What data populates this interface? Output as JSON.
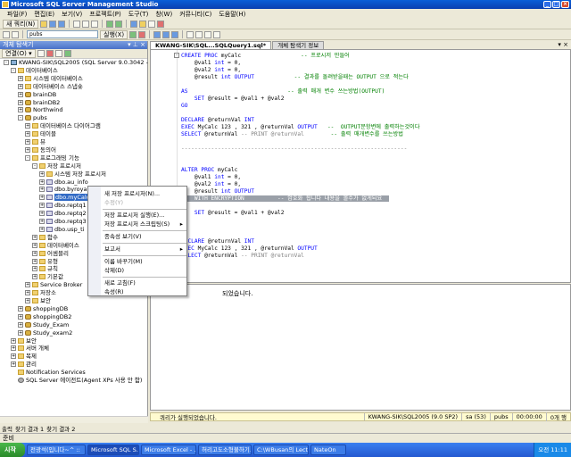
{
  "window": {
    "title": "Microsoft SQL Server Management Studio"
  },
  "menu": [
    "파일(F)",
    "편집(E)",
    "보기(V)",
    "프로젝트(P)",
    "도구(T)",
    "창(W)",
    "커뮤니티(C)",
    "도움말(H)"
  ],
  "toolbar": {
    "new_query": "새 쿼리(N)",
    "db_select": "pubs",
    "execute": "실행(X)"
  },
  "object_explorer": {
    "title": "개체 탐색기",
    "connect": "연결(O) ▾",
    "tree": [
      {
        "label": "KWANG-SIK\\SQL2005 (SQL Server 9.0.3042 - sa",
        "depth": 0,
        "icon": "server",
        "exp": "-"
      },
      {
        "label": "데이터베이스",
        "depth": 1,
        "icon": "folder",
        "exp": "-"
      },
      {
        "label": "시스템 데이터베이스",
        "depth": 2,
        "icon": "folder",
        "exp": "+"
      },
      {
        "label": "데이터베이스 스냅숏",
        "depth": 2,
        "icon": "folder",
        "exp": "+"
      },
      {
        "label": "brainDB",
        "depth": 2,
        "icon": "db",
        "exp": "+"
      },
      {
        "label": "brainDB2",
        "depth": 2,
        "icon": "db",
        "exp": "+"
      },
      {
        "label": "Northwind",
        "depth": 2,
        "icon": "db",
        "exp": "+"
      },
      {
        "label": "pubs",
        "depth": 2,
        "icon": "db",
        "exp": "-"
      },
      {
        "label": "데이터베이스 다이어그램",
        "depth": 3,
        "icon": "folder",
        "exp": "+"
      },
      {
        "label": "테이블",
        "depth": 3,
        "icon": "folder",
        "exp": "+"
      },
      {
        "label": "뷰",
        "depth": 3,
        "icon": "folder",
        "exp": "+"
      },
      {
        "label": "동의어",
        "depth": 3,
        "icon": "folder",
        "exp": "+"
      },
      {
        "label": "프로그래밍 기능",
        "depth": 3,
        "icon": "folder",
        "exp": "-"
      },
      {
        "label": "저장 프로시저",
        "depth": 4,
        "icon": "folder",
        "exp": "-"
      },
      {
        "label": "시스템 저장 프로시저",
        "depth": 5,
        "icon": "folder",
        "exp": "+"
      },
      {
        "label": "dbo.au_info",
        "depth": 5,
        "icon": "sp",
        "exp": "+"
      },
      {
        "label": "dbo.byroyalty",
        "depth": 5,
        "icon": "sp",
        "exp": "+"
      },
      {
        "label": "dbo.myCalc",
        "depth": 5,
        "icon": "sp",
        "exp": "+",
        "selected": true
      },
      {
        "label": "dbo.reptq1",
        "depth": 5,
        "icon": "sp",
        "exp": "+"
      },
      {
        "label": "dbo.reptq2",
        "depth": 5,
        "icon": "sp",
        "exp": "+"
      },
      {
        "label": "dbo.reptq3",
        "depth": 5,
        "icon": "sp",
        "exp": "+"
      },
      {
        "label": "dbo.usp_ti",
        "depth": 5,
        "icon": "sp",
        "exp": "+"
      },
      {
        "label": "함수",
        "depth": 4,
        "icon": "folder",
        "exp": "+"
      },
      {
        "label": "데이터베이스",
        "depth": 4,
        "icon": "folder",
        "exp": "+"
      },
      {
        "label": "어셈블리",
        "depth": 4,
        "icon": "folder",
        "exp": "+"
      },
      {
        "label": "유형",
        "depth": 4,
        "icon": "folder",
        "exp": "+"
      },
      {
        "label": "규칙",
        "depth": 4,
        "icon": "folder",
        "exp": "+"
      },
      {
        "label": "기본값",
        "depth": 4,
        "icon": "folder",
        "exp": "+"
      },
      {
        "label": "Service Broker",
        "depth": 3,
        "icon": "folder",
        "exp": "+"
      },
      {
        "label": "저장소",
        "depth": 3,
        "icon": "folder",
        "exp": "+"
      },
      {
        "label": "보안",
        "depth": 3,
        "icon": "folder",
        "exp": "+"
      },
      {
        "label": "shoppingDB",
        "depth": 2,
        "icon": "db",
        "exp": "+"
      },
      {
        "label": "shoppingDB2",
        "depth": 2,
        "icon": "db",
        "exp": "+"
      },
      {
        "label": "Study_Exam",
        "depth": 2,
        "icon": "db",
        "exp": "+"
      },
      {
        "label": "Study_exam2",
        "depth": 2,
        "icon": "db",
        "exp": "+"
      },
      {
        "label": "보안",
        "depth": 1,
        "icon": "folder",
        "exp": "+"
      },
      {
        "label": "서버 개체",
        "depth": 1,
        "icon": "folder",
        "exp": "+"
      },
      {
        "label": "복제",
        "depth": 1,
        "icon": "folder",
        "exp": "+"
      },
      {
        "label": "관리",
        "depth": 1,
        "icon": "folder",
        "exp": "+"
      },
      {
        "label": "Notification Services",
        "depth": 1,
        "icon": "folder",
        "exp": ""
      },
      {
        "label": "SQL Server 에이전트(Agent XPs 사용 안 함)",
        "depth": 1,
        "icon": "gear",
        "exp": ""
      }
    ]
  },
  "tabs": [
    {
      "label": "KWANG-SIK\\SQL...SQLQuery1.sql*",
      "active": true
    },
    {
      "label": "개체 탐색기 정보",
      "active": false
    }
  ],
  "code": [
    {
      "parts": [
        [
          "kw",
          "CREATE PROC "
        ],
        [
          "",
          "myCalc"
        ],
        [
          "",
          "                  "
        ],
        [
          "cm",
          "-- 프로시저 만들어"
        ]
      ]
    },
    {
      "parts": [
        [
          "",
          "    @val1 "
        ],
        [
          "kw",
          "int"
        ],
        [
          "",
          " = 0,"
        ]
      ]
    },
    {
      "parts": [
        [
          "",
          "    @val2 "
        ],
        [
          "kw",
          "int"
        ],
        [
          "",
          " = 0,"
        ]
      ]
    },
    {
      "parts": [
        [
          "",
          "    @result "
        ],
        [
          "kw",
          "int OUTPUT"
        ],
        [
          "",
          "            "
        ],
        [
          "cm",
          "-- 결과를 돌려받을때는 OUTPUT 으로 적는다"
        ]
      ]
    },
    {
      "parts": []
    },
    {
      "parts": [
        [
          "kw",
          "AS"
        ],
        [
          "",
          "                              "
        ],
        [
          "cm",
          "-- 출력 매개 변수 쓰는방법(OUTPUT)"
        ]
      ]
    },
    {
      "parts": [
        [
          "",
          "    "
        ],
        [
          "kw",
          "SET "
        ],
        [
          "",
          "@result = @val1 + @val2"
        ]
      ]
    },
    {
      "parts": [
        [
          "kw",
          "GO"
        ]
      ]
    },
    {
      "parts": []
    },
    {
      "parts": [
        [
          "kw",
          "DECLARE "
        ],
        [
          "",
          "@returnVal "
        ],
        [
          "kw",
          "INT"
        ]
      ]
    },
    {
      "parts": [
        [
          "kw",
          "EXEC "
        ],
        [
          "",
          "MyCalc 123 , 321 , @returnVal "
        ],
        [
          "kw",
          "OUTPUT"
        ],
        [
          "",
          "   "
        ],
        [
          "cm",
          "--  OUTPUT문항변에 출력하는것이다"
        ]
      ]
    },
    {
      "parts": [
        [
          "kw",
          "SELECT "
        ],
        [
          "",
          "@returnVal "
        ],
        [
          "pk",
          "-- PRINT @returnVal"
        ],
        [
          "",
          "        "
        ],
        [
          "cm",
          "-- 출력 매개변수를 쓰는방법"
        ]
      ]
    },
    {
      "parts": []
    },
    {
      "parts": [
        [
          "pk",
          "--------------------------------------------------------------------"
        ]
      ]
    },
    {
      "parts": []
    },
    {
      "parts": []
    },
    {
      "parts": [
        [
          "kw",
          "ALTER PROC "
        ],
        [
          "",
          "myCalc"
        ]
      ]
    },
    {
      "parts": [
        [
          "",
          "    @val1 "
        ],
        [
          "kw",
          "int"
        ],
        [
          "",
          " = 0,"
        ]
      ]
    },
    {
      "parts": [
        [
          "",
          "    @val2 "
        ],
        [
          "kw",
          "int"
        ],
        [
          "",
          " = 0,"
        ]
      ]
    },
    {
      "parts": [
        [
          "",
          "    @result "
        ],
        [
          "kw",
          "int OUTPUT"
        ]
      ]
    },
    {
      "parts": [
        [
          "hl",
          "AS  WITH ENCRYPTION          -- 암호화 됩니다 내용을 볼수가 없게되요  "
        ]
      ]
    },
    {
      "parts": []
    },
    {
      "parts": [
        [
          "",
          "    "
        ],
        [
          "kw",
          "SET "
        ],
        [
          "",
          "@result = @val1 + @val2"
        ]
      ]
    },
    {
      "parts": []
    },
    {
      "parts": []
    },
    {
      "parts": []
    },
    {
      "parts": [
        [
          "kw",
          "DECLARE "
        ],
        [
          "",
          "@returnVal "
        ],
        [
          "kw",
          "INT"
        ]
      ]
    },
    {
      "parts": [
        [
          "kw",
          "EXEC "
        ],
        [
          "",
          "MyCalc 123 , 321 , @returnVal "
        ],
        [
          "kw",
          "OUTPUT"
        ]
      ]
    },
    {
      "parts": [
        [
          "kw",
          "SELECT "
        ],
        [
          "",
          "@returnVal "
        ],
        [
          "pk",
          "-- PRINT @returnVal"
        ]
      ]
    }
  ],
  "results": {
    "message": "되었습니다."
  },
  "context_menu": {
    "items": [
      {
        "label": "새 저장 프로시저(N)...",
        "disabled": false,
        "arrow": false
      },
      {
        "label": "수정(Y)",
        "disabled": true,
        "arrow": false
      },
      {
        "sep": true
      },
      {
        "label": "저장 프로시저 실행(E)...",
        "disabled": false,
        "arrow": false
      },
      {
        "label": "저장 프로시저 스크립팅(S)",
        "disabled": false,
        "arrow": true
      },
      {
        "sep": true
      },
      {
        "label": "종속성 보기(V)",
        "disabled": false,
        "arrow": false
      },
      {
        "sep": true
      },
      {
        "label": "보고서",
        "disabled": false,
        "arrow": true
      },
      {
        "sep": true
      },
      {
        "label": "이름 바꾸기(M)",
        "disabled": false,
        "arrow": false
      },
      {
        "label": "삭제(D)",
        "disabled": false,
        "arrow": false
      },
      {
        "sep": true
      },
      {
        "label": "새로 고침(F)",
        "disabled": false,
        "arrow": false
      },
      {
        "label": "속성(R)",
        "disabled": false,
        "arrow": false
      }
    ]
  },
  "query_status": {
    "message": "쿼리가 실행되었습니다.",
    "server": "KWANG-SIK\\SQL2005 (9.0 SP2)",
    "user": "sa (53)",
    "db": "pubs",
    "time": "00:00:00",
    "rows": "0개 행"
  },
  "bottom_tabs": [
    "출력",
    "찾기 결과 1",
    "찾기 결과 2"
  ],
  "status": {
    "text": "준비"
  },
  "taskbar": {
    "start": "시작",
    "tasks": [
      {
        "label": "전광석(입니다~^ ::",
        "active": false
      },
      {
        "label": "Microsoft SQL S...",
        "active": true
      },
      {
        "label": "Microsoft Excel - ...",
        "active": false
      },
      {
        "label": "허리고도소형불하기...",
        "active": false
      },
      {
        "label": "C:\\WBusan의 Lect...",
        "active": false
      },
      {
        "label": "NateOn",
        "active": false
      }
    ],
    "clock": "오전 11:11"
  }
}
